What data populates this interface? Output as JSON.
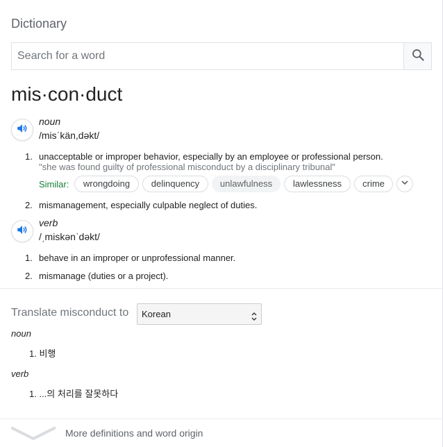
{
  "header": {
    "title": "Dictionary"
  },
  "search": {
    "placeholder": "Search for a word",
    "value": ""
  },
  "entry": {
    "word": "mis·con·duct",
    "noun": {
      "pos": "noun",
      "phonetic": "/misˈkän,dəkt/",
      "defs": [
        {
          "num": "1.",
          "text": "unacceptable or improper behavior, especially by an employee or professional person.",
          "example": "\"she was found guilty of professional misconduct by a disciplinary tribunal\""
        },
        {
          "num": "2.",
          "text": "mismanagement, especially culpable neglect of duties."
        }
      ],
      "similar_label": "Similar:",
      "similar": [
        "wrongdoing",
        "delinquency",
        "unlawfulness",
        "lawlessness",
        "crime"
      ]
    },
    "verb": {
      "pos": "verb",
      "phonetic": "/ˌmiskənˈdəkt/",
      "defs": [
        {
          "num": "1.",
          "text": "behave in an improper or unprofessional manner."
        },
        {
          "num": "2.",
          "text": "mismanage (duties or a project)."
        }
      ]
    }
  },
  "translate": {
    "label": "Translate misconduct to",
    "language": "Korean",
    "noun_label": "noun",
    "noun_item": "1. 비행",
    "verb_label": "verb",
    "verb_item": "1. ...의 처리를 잘못하다"
  },
  "footer": {
    "more": "More definitions and word origin"
  },
  "colors": {
    "similar_green": "#188038",
    "speaker_blue": "#1a73e8"
  },
  "icons": [
    "search-icon",
    "speaker-icon",
    "chevron-down-icon",
    "select-arrows-icon"
  ]
}
